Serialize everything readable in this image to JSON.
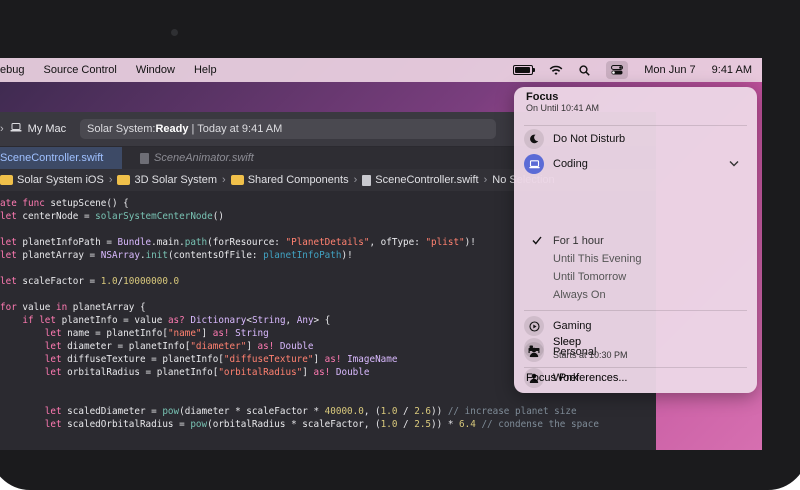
{
  "menubar": {
    "items": [
      "ebug",
      "Source Control",
      "Window",
      "Help"
    ],
    "date": "Mon Jun 7",
    "time": "9:41 AM"
  },
  "toolbar": {
    "destination": "My Mac",
    "status_prefix": "Solar System: ",
    "status_state": "Ready",
    "status_suffix": " | Today at 9:41 AM"
  },
  "tabs": {
    "active": "SceneController.swift",
    "inactive": "SceneAnimator.swift"
  },
  "jumpbar": {
    "crumbs": [
      "Solar System iOS",
      "3D Solar System",
      "Shared Components",
      "SceneController.swift",
      "No Selection"
    ]
  },
  "focus": {
    "title": "Focus",
    "subtitle": "On Until 10:41 AM",
    "dnd": "Do Not Disturb",
    "coding": "Coding",
    "options": [
      "For 1 hour",
      "Until This Evening",
      "Until Tomorrow",
      "Always On"
    ],
    "gaming": "Gaming",
    "personal": "Personal",
    "work": "Work",
    "sleep": "Sleep",
    "sleep_sub": "Starts at 10:30 PM",
    "preferences": "Focus Preferences..."
  },
  "colors": {
    "accent": "#5b6bd6",
    "editor_bg": "#2b2a30",
    "keyword": "#ff7ab2",
    "string": "#ff8170"
  },
  "icons": {
    "battery": "battery-icon",
    "wifi": "wifi-icon",
    "search": "search-icon",
    "control_center": "control-center-icon",
    "moon": "moon-icon",
    "laptop": "laptop-icon",
    "gaming": "gamepad-icon",
    "person": "person-icon",
    "work": "briefcase-icon",
    "sleep": "bed-icon",
    "check": "checkmark-icon",
    "chevron": "chevron-down-icon"
  },
  "code": {
    "l1": "ate func setupScene() {",
    "l2": "let centerNode = solarSystemCenterNode()",
    "l3": "let planetInfoPath = Bundle.main.path(forResource: \"PlanetDetails\", ofType: \"plist\")!",
    "l4": "let planetArray = NSArray.init(contentsOfFile: planetInfoPath)!",
    "l5": "let scaleFactor = 1.0/10000000.0",
    "l6": "for value in planetArray {",
    "l7": "    if let planetInfo = value as? Dictionary<String, Any> {",
    "l8": "        let name = planetInfo[\"name\"] as! String",
    "l9": "        let diameter = planetInfo[\"diameter\"] as! Double",
    "l10": "        let diffuseTexture = planetInfo[\"diffuseTexture\"] as! ImageName",
    "l11": "        let orbitalRadius = planetInfo[\"orbitalRadius\"] as! Double",
    "l12": "        let scaledDiameter = pow(diameter * scaleFactor * 40000.0, (1.0 / 2.6)) // increase planet size",
    "l13": "        let scaledOrbitalRadius = pow(orbitalRadius * scaleFactor, (1.0 / 2.5)) * 6.4 // condense the space"
  }
}
